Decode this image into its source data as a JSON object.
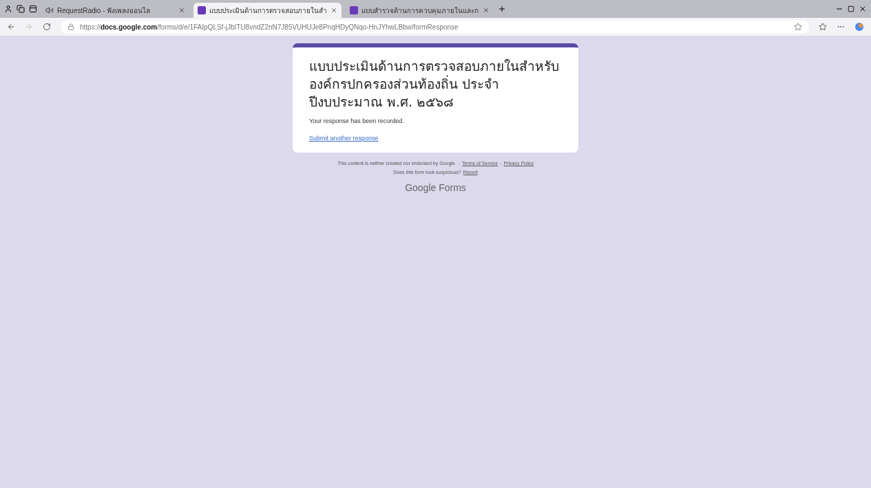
{
  "browser": {
    "tabs": [
      {
        "kind": "audio",
        "label": "RequestRadio - ฟังเพลงออนไล",
        "selected": false
      },
      {
        "kind": "form",
        "label": "แบบประเมินด้านการตรวจสอบภายในสำ",
        "selected": true
      },
      {
        "kind": "form",
        "label": "แบบสำรวจด้านการควบคุมภายในและก",
        "selected": false
      }
    ],
    "address": "https://**docs.google.com**/forms/d/e/1FAIpQLSf-jJbITU8vndZ2nN7J85VUHUJe8PnqHDyQNqo-HnJYhwLBbw/formResponse"
  },
  "form": {
    "title": "แบบประเมินด้านการตรวจสอบภายในสำหรับองค์กรปกครองส่วนท้องถิ่น ประจำปีงบประมาณ พ.ศ. ๒๕๖๘",
    "message": "Your response has been recorded.",
    "link": "Submit another response"
  },
  "footer": {
    "disclaimer": "This content is neither created nor endorsed by Google.",
    "separators": [
      "-",
      "-"
    ],
    "terms": "Terms of Service",
    "privacy": "Privacy Policy",
    "question": "Does this form look suspicious?",
    "report": "Report",
    "brand": "Google Forms"
  }
}
